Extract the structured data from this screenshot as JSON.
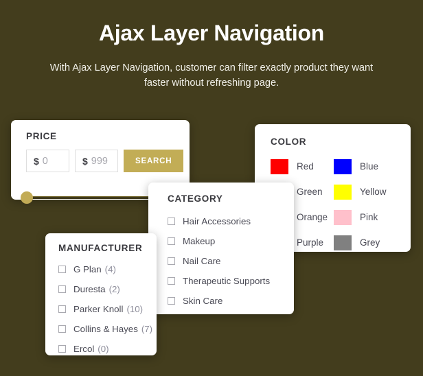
{
  "header": {
    "title": "Ajax Layer Navigation",
    "subtitle": "With Ajax Layer Navigation, customer can filter exactly product they want faster without refreshing page."
  },
  "theme": {
    "background": "#433d1d",
    "accent": "#c2ad56",
    "panel_background": "#ffffff",
    "heading_color": "#3a3a3f",
    "text_color": "#4a4a55"
  },
  "price": {
    "title": "PRICE",
    "min": {
      "currency": "$",
      "value": "0",
      "placeholder": "0"
    },
    "max": {
      "currency": "$",
      "value": "999",
      "placeholder": "999"
    },
    "search_label": "SEARCH",
    "slider": {
      "handle_position_percent": 0,
      "track_color": "#3f3a1c",
      "handle_color": "#c2ab56"
    }
  },
  "color": {
    "title": "COLOR",
    "options": [
      {
        "label": "Red",
        "swatch": "#fe0000"
      },
      {
        "label": "Blue",
        "swatch": "#0000fe"
      },
      {
        "label": "Green",
        "swatch": "#008000"
      },
      {
        "label": "Yellow",
        "swatch": "#ffff00"
      },
      {
        "label": "Orange",
        "swatch": "#ffa500"
      },
      {
        "label": "Pink",
        "swatch": "#ffc0cb"
      },
      {
        "label": "Purple",
        "swatch": "#800080"
      },
      {
        "label": "Grey",
        "swatch": "#808080"
      }
    ]
  },
  "category": {
    "title": "CATEGORY",
    "items": [
      {
        "label": "Hair Accessories",
        "checked": false
      },
      {
        "label": "Makeup",
        "checked": false
      },
      {
        "label": "Nail Care",
        "checked": false
      },
      {
        "label": "Therapeutic Supports",
        "checked": false
      },
      {
        "label": "Skin Care",
        "checked": false
      }
    ]
  },
  "manufacturer": {
    "title": "MANUFACTURER",
    "items": [
      {
        "label": "G Plan",
        "count": "(4)",
        "checked": false
      },
      {
        "label": "Duresta",
        "count": "(2)",
        "checked": false
      },
      {
        "label": "Parker Knoll",
        "count": "(10)",
        "checked": false
      },
      {
        "label": "Collins & Hayes",
        "count": "(7)",
        "checked": false
      },
      {
        "label": "Ercol",
        "count": "(0)",
        "checked": false
      }
    ]
  }
}
